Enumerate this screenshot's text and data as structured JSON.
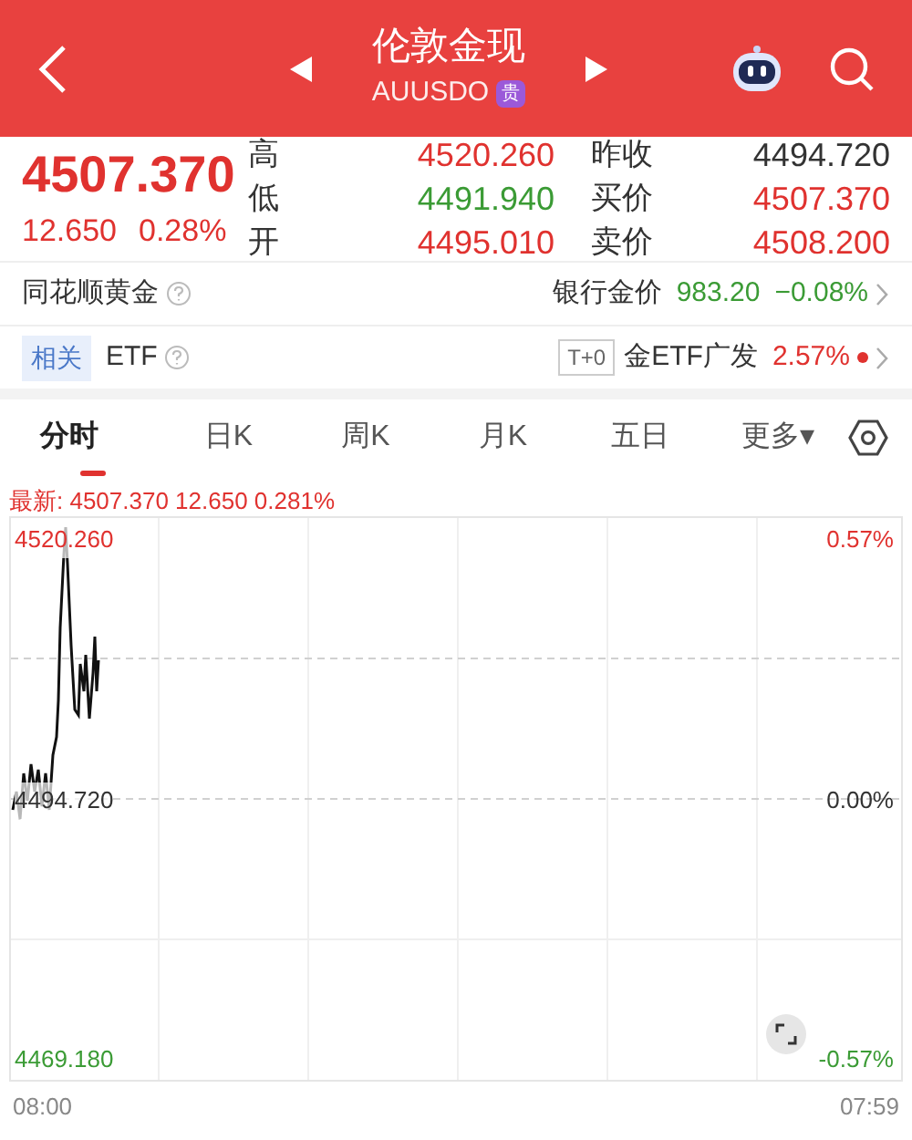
{
  "header": {
    "title": "伦敦金现",
    "symbol": "AUUSDO",
    "badge": "贵"
  },
  "quote": {
    "price": "4507.370",
    "change": "12.650",
    "change_pct": "0.28%",
    "stats": [
      {
        "label": "高",
        "value": "4520.260",
        "color": "#e0322f"
      },
      {
        "label": "低",
        "value": "4491.940",
        "color": "#3b9b35"
      },
      {
        "label": "开",
        "value": "4495.010",
        "color": "#e0322f"
      },
      {
        "label": "昨收",
        "value": "4494.720",
        "color": "#333333"
      },
      {
        "label": "买价",
        "value": "4507.370",
        "color": "#e0322f"
      },
      {
        "label": "卖价",
        "value": "4508.200",
        "color": "#e0322f"
      }
    ]
  },
  "info_rows": [
    {
      "label": "同花顺黄金",
      "right_label": "银行金价",
      "right_value": "983.20",
      "right_change": "−0.08%",
      "color": "#3b9b35",
      "dot": false
    },
    {
      "tag": "相关",
      "label": "ETF",
      "right_tag": "T+0",
      "right_label": "金ETF广发",
      "right_change": "2.57%",
      "color": "#e0322f",
      "dot": true
    }
  ],
  "tabs": [
    {
      "label": "分时",
      "selected": true
    },
    {
      "label": "日K",
      "selected": false
    },
    {
      "label": "周K",
      "selected": false
    },
    {
      "label": "月K",
      "selected": false
    },
    {
      "label": "五日",
      "selected": false
    },
    {
      "label": "更多▾",
      "selected": false
    }
  ],
  "chart": {
    "latest": "最新: 4507.370  12.650  0.281%",
    "y_left": [
      {
        "label": "4520.260",
        "color": "#e0322f"
      },
      {
        "label": "4494.720",
        "color": "#333333"
      },
      {
        "label": "4469.180",
        "color": "#3b9b35"
      }
    ],
    "y_right": [
      {
        "label": "0.57%",
        "color": "#e0322f"
      },
      {
        "label": "0.00%",
        "color": "#333333"
      },
      {
        "label": "-0.57%",
        "color": "#3b9b35"
      }
    ],
    "x_labels": [
      "08:00",
      "07:59"
    ]
  }
}
